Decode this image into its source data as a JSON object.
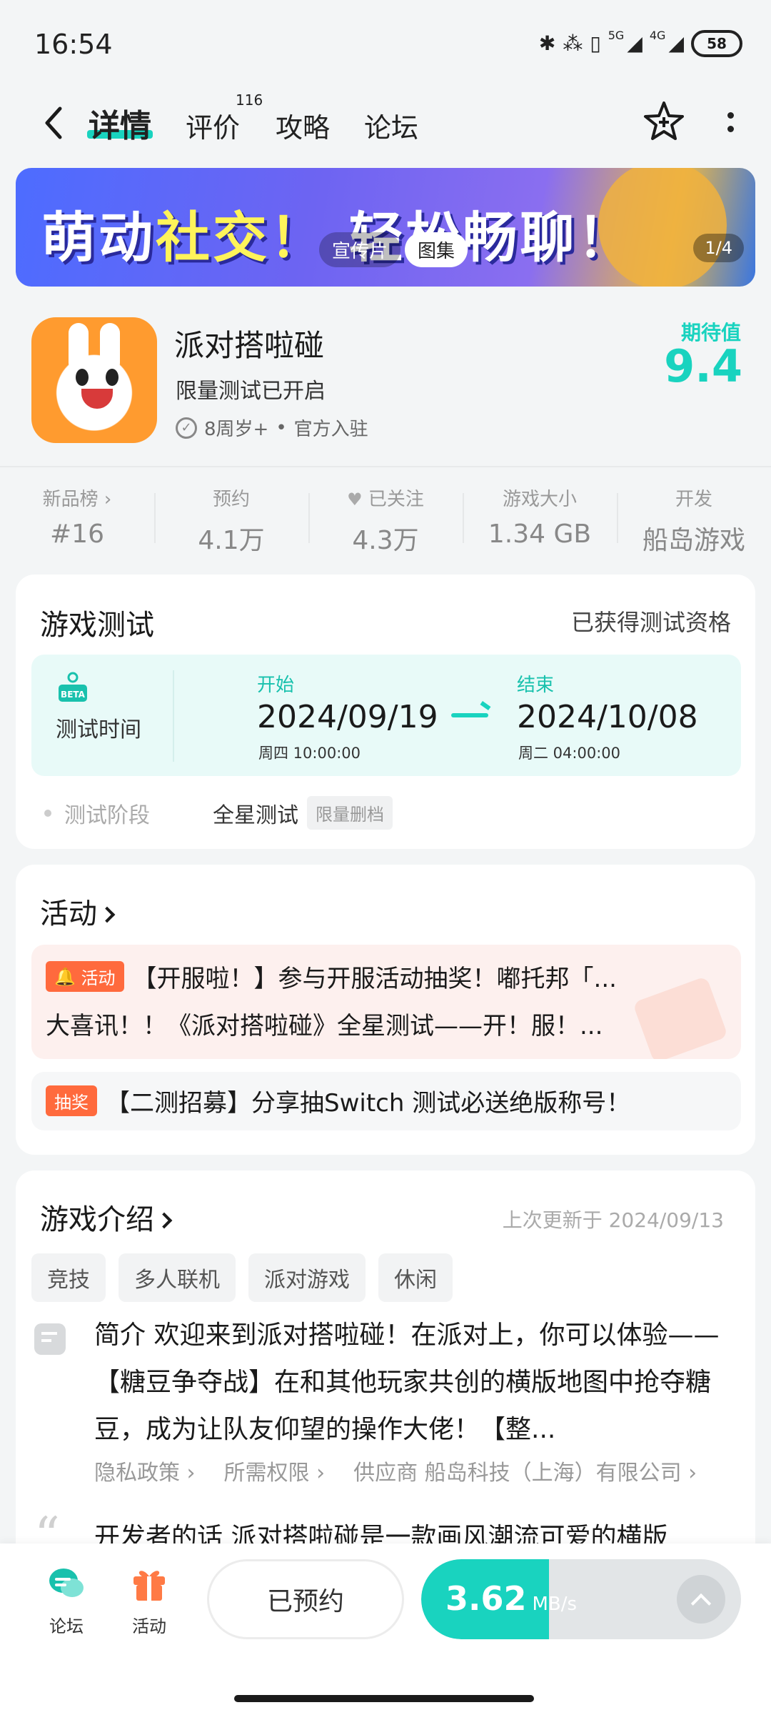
{
  "status_bar": {
    "time": "16:54",
    "net_5g": "5G",
    "net_4g": "4G",
    "battery": "58"
  },
  "nav": {
    "tabs": [
      {
        "label": "详情",
        "active": true
      },
      {
        "label": "评价",
        "count": "116"
      },
      {
        "label": "攻略"
      },
      {
        "label": "论坛"
      }
    ]
  },
  "banner": {
    "title_part1": "萌动",
    "title_part2": "社交！",
    "title_part3": "轻松畅聊！",
    "pill_video": "宣传片",
    "pill_gallery": "图集",
    "counter": "1/4"
  },
  "app": {
    "name": "派对搭啦碰",
    "subtitle": "限量测试已开启",
    "age": "8周岁+",
    "official": "官方入驻",
    "rating_label": "期待值",
    "rating_value": "9.4"
  },
  "stats": [
    {
      "label": "新品榜 ›",
      "value": "#16"
    },
    {
      "label": "预约",
      "value": "4.1万"
    },
    {
      "label": "已关注",
      "value": "4.3万"
    },
    {
      "label": "游戏大小",
      "value": "1.34 GB"
    },
    {
      "label": "开发",
      "value": "船岛游戏"
    }
  ],
  "test": {
    "title": "游戏测试",
    "qualification": "已获得测试资格",
    "time_label": "测试时间",
    "beta": "BETA",
    "start_label": "开始",
    "start_date": "2024/09/19",
    "start_time": "周四  10:00:00",
    "end_label": "结束",
    "end_date": "2024/10/08",
    "end_time": "周二  04:00:00",
    "stage_label": "测试阶段",
    "stage_value": "全星测试",
    "stage_tag": "限量删档"
  },
  "activity": {
    "title": "活动",
    "items": [
      {
        "tag": "活动",
        "text": "【开服啦！】参与开服活动抽奖！嘟托邦「...",
        "line2": "大喜讯！！《派对搭啦碰》全星测试——开！服！..."
      },
      {
        "tag": "抽奖",
        "text": "【二测招募】分享抽Switch 测试必送绝版称号！"
      }
    ]
  },
  "intro": {
    "title": "游戏介绍",
    "updated": "上次更新于 2024/09/13",
    "tags": [
      "竞技",
      "多人联机",
      "派对游戏",
      "休闲"
    ],
    "text": "简介 欢迎来到派对搭啦碰！在派对上，你可以体验——【糖豆争夺战】在和其他玩家共创的横版地图中抢夺糖豆，成为让队友仰望的操作大佬！【整...",
    "links": [
      "隐私政策 ›",
      "所需权限 ›",
      "供应商 船岛科技（上海）有限公司 ›"
    ],
    "dev_words": "开发者的话 派对搭啦碰是一款画风潮流可爱的横版"
  },
  "bottom": {
    "forum": "论坛",
    "events": "活动",
    "reserved": "已预约",
    "speed_value": "3.62",
    "speed_unit": "MB/s",
    "download_progress": 0.4
  },
  "colors": {
    "accent": "#19d3bf",
    "activity_tag": "#ff6a3d",
    "bg": "#f3f5f6"
  }
}
